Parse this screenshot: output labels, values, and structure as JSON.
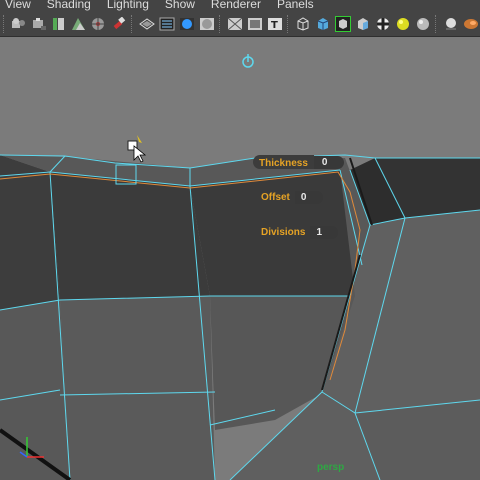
{
  "menubar": {
    "items": [
      "View",
      "Shading",
      "Lighting",
      "Show",
      "Renderer",
      "Panels"
    ]
  },
  "toolbar": {
    "icons": [
      "select-camera-icon",
      "camera-attributes-icon",
      "bookmark-icon",
      "image-plane-icon",
      "grid-icon",
      "film-gate-icon",
      "resolution-gate-icon",
      "wireframe-icon",
      "smooth-shade-all-icon",
      "shaded-icon",
      "textured-icon",
      "xray-icon",
      "xray-joints-icon",
      "text-icon",
      "wireframe-cube-icon",
      "smooth-shaded-cube-icon",
      "isolate-select-icon",
      "flat-cube-icon",
      "checker-icon",
      "lights-icon",
      "shadows-icon",
      "material-sphere-icon",
      "motion-blur-icon"
    ]
  },
  "hud": {
    "thickness_label": "Thickness",
    "thickness_value": "0",
    "offset_label": "Offset",
    "offset_value": "0",
    "divisions_label": "Divisions",
    "divisions_value": "1"
  },
  "viewport": {
    "camera_name": "persp",
    "axis_labels": {
      "x": "x",
      "y": "y"
    }
  },
  "colors": {
    "wire": "#5ed8ee",
    "hud_label": "#e6a325",
    "camera_label": "#2ea843"
  }
}
